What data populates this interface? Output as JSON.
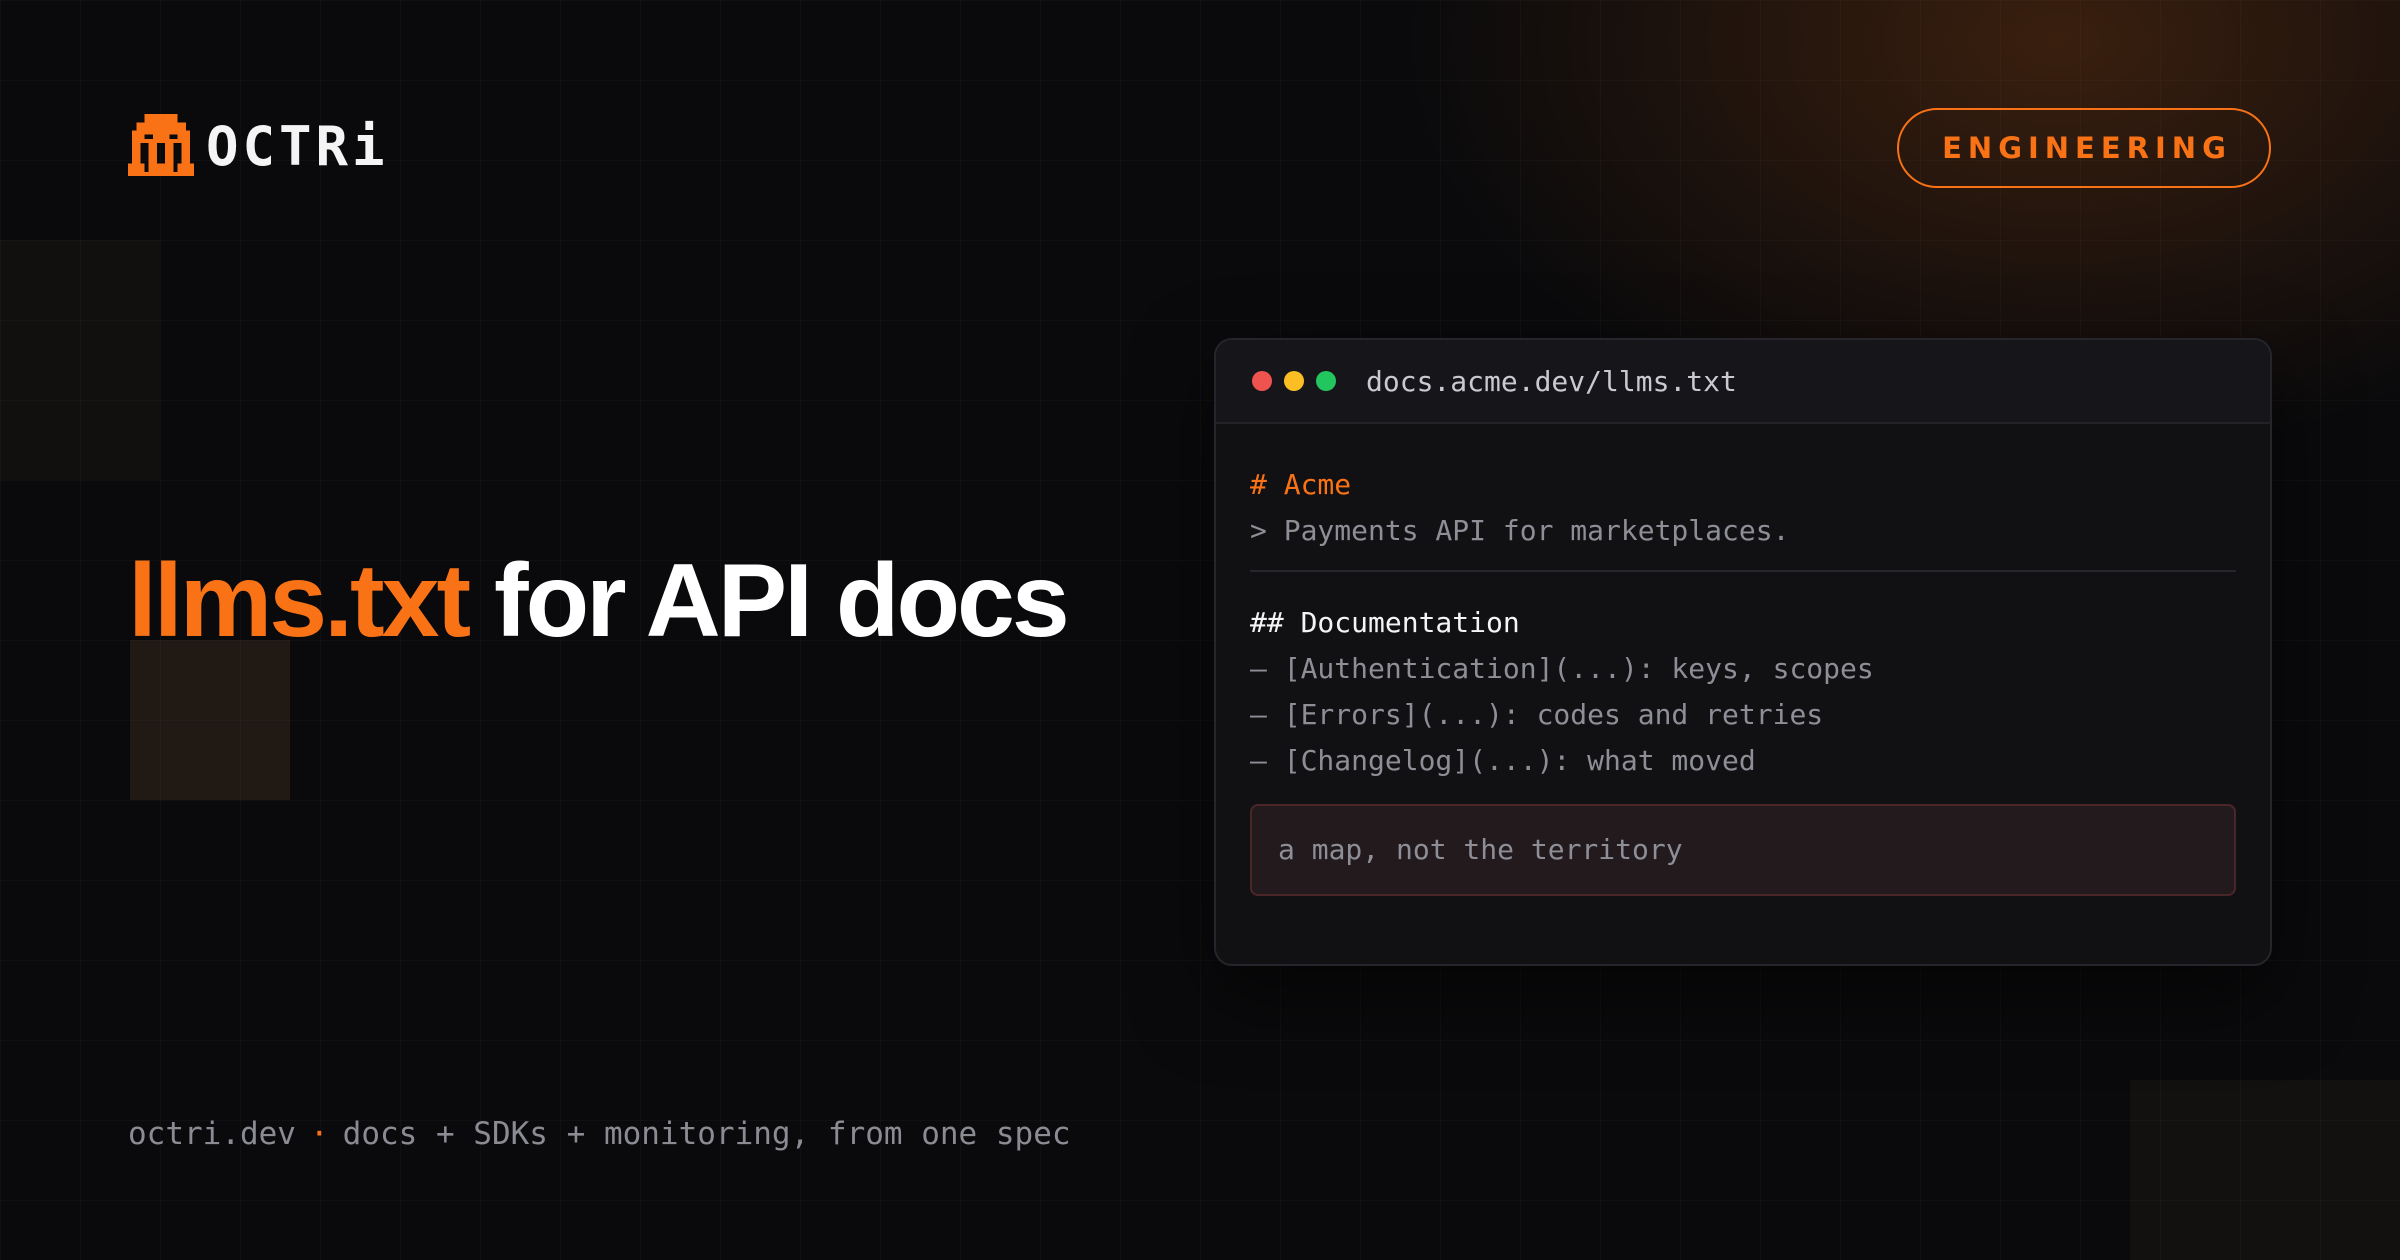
{
  "brand": {
    "name": "OCTRi",
    "logo_icon": "octopus-pixel-icon",
    "accent_color": "#f97316"
  },
  "badge": {
    "label": "ENGINEERING"
  },
  "headline": {
    "accent": "llms.txt",
    "rest": " for API docs"
  },
  "code_window": {
    "url": "docs.acme.dev/llms.txt",
    "lines": {
      "title": "# Acme",
      "summary": "> Payments API for marketplaces.",
      "section": "## Documentation",
      "item_1": "– [Authentication](...): keys, scopes",
      "item_2": "– [Errors](...): codes and retries",
      "item_3": "– [Changelog](...): what moved"
    },
    "note": "a map, not the territory",
    "window_controls": [
      "close-dot",
      "minimize-dot",
      "maximize-dot"
    ]
  },
  "footer": {
    "site": "octri.dev",
    "separator": "·",
    "tagline": "docs + SDKs + monitoring, from one spec"
  }
}
